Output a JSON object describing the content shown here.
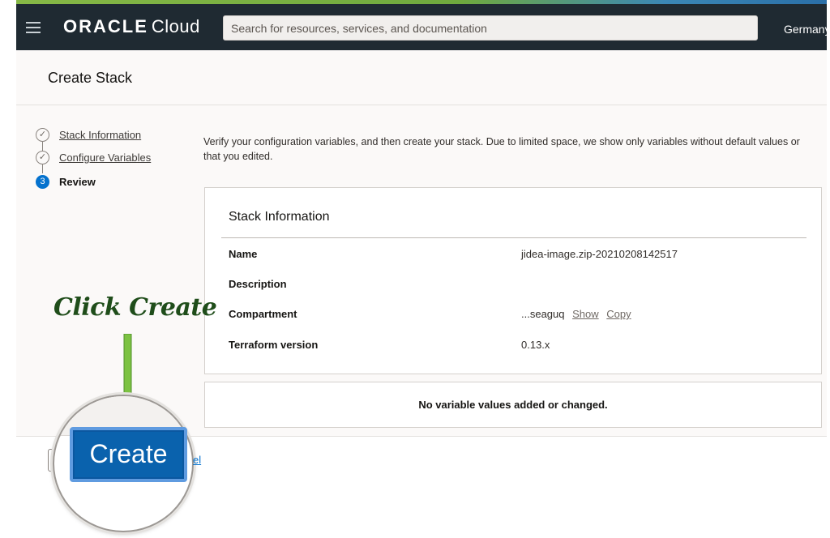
{
  "header": {
    "logo_brand": "ORACLE",
    "logo_product": "Cloud",
    "search_placeholder": "Search for resources, services, and documentation",
    "region": "Germany"
  },
  "page": {
    "title": "Create Stack"
  },
  "steps": [
    {
      "label": "Stack Information",
      "state": "complete"
    },
    {
      "label": "Configure Variables",
      "state": "complete"
    },
    {
      "number": "3",
      "label": "Review",
      "state": "current"
    }
  ],
  "intro": "Verify your configuration variables, and then create your stack. Due to limited space, we show only variables without default values or that you edited.",
  "stack_info": {
    "heading": "Stack Information",
    "rows": [
      {
        "key": "Name",
        "value": "jidea-image.zip-20210208142517"
      },
      {
        "key": "Description",
        "value": ""
      },
      {
        "key": "Compartment",
        "value": "...seaguq",
        "links": [
          "Show",
          "Copy"
        ]
      },
      {
        "key": "Terraform version",
        "value": "0.13.x"
      }
    ]
  },
  "variables_message": "No variable values added or changed.",
  "footer": {
    "create_label": "Create",
    "cancel_fragment": "el"
  },
  "annotation": {
    "text": "Click Create",
    "color": "#1f4d1a",
    "arrow_color": "#7cc242"
  },
  "colors": {
    "accent": "#0572ce",
    "topbar": "#1f2a32"
  }
}
